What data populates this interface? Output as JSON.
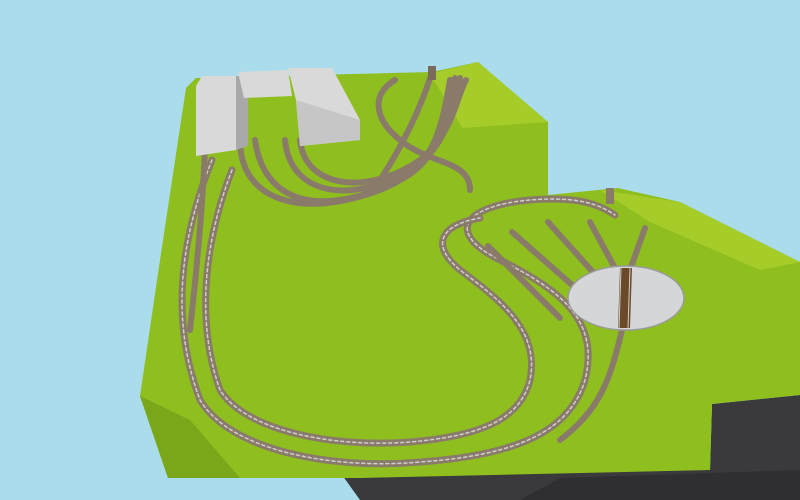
{
  "colors": {
    "sky": "#aadcec",
    "grass": "#8fbf1f",
    "grass_light": "#a6cc2a",
    "grass_dark": "#6f9a16",
    "cliff": "#3a3a3c",
    "ballast": "#8a7a6a",
    "rail": "#cfcfcf",
    "sleeper": "#5e4a3a",
    "building": "#d9d9d9",
    "building_shade": "#a9a9a9",
    "turntable_pit": "#d4d6d8",
    "turntable_bridge": "#6b4a2a"
  },
  "icons": {
    "engine_shed": "building",
    "turntable": "turntable",
    "signal_tower_left": "tower",
    "signal_tower_right": "tower"
  },
  "layers": [
    "sky",
    "terrain",
    "cliffs",
    "tracks",
    "buildings",
    "turntable"
  ]
}
